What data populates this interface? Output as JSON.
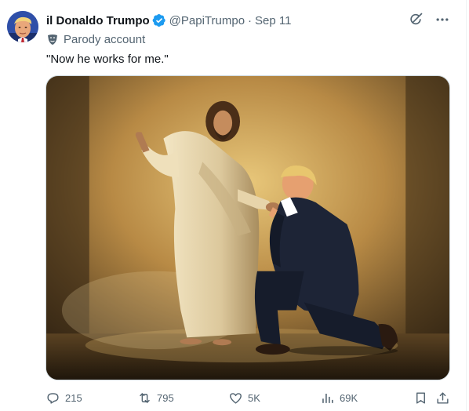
{
  "post": {
    "display_name": "il Donaldo Trumpo",
    "handle": "@PapiTrumpo",
    "separator": "·",
    "date": "Sep 11",
    "label_icon": "mask-icon",
    "label": "Parody account",
    "text": "\"Now he works for me.\"",
    "image_icon": "painting-image"
  },
  "actions": {
    "replies": "215",
    "reposts": "795",
    "likes": "5K",
    "views": "69K",
    "icons": [
      "reply-icon",
      "retweet-icon",
      "heart-icon",
      "views-icon",
      "bookmark-icon",
      "share-icon"
    ]
  },
  "header_icons": [
    "grok-icon",
    "more-icon"
  ],
  "colors": {
    "verified": "#1d9bf0",
    "muted": "#536471",
    "text": "#0f1419"
  }
}
